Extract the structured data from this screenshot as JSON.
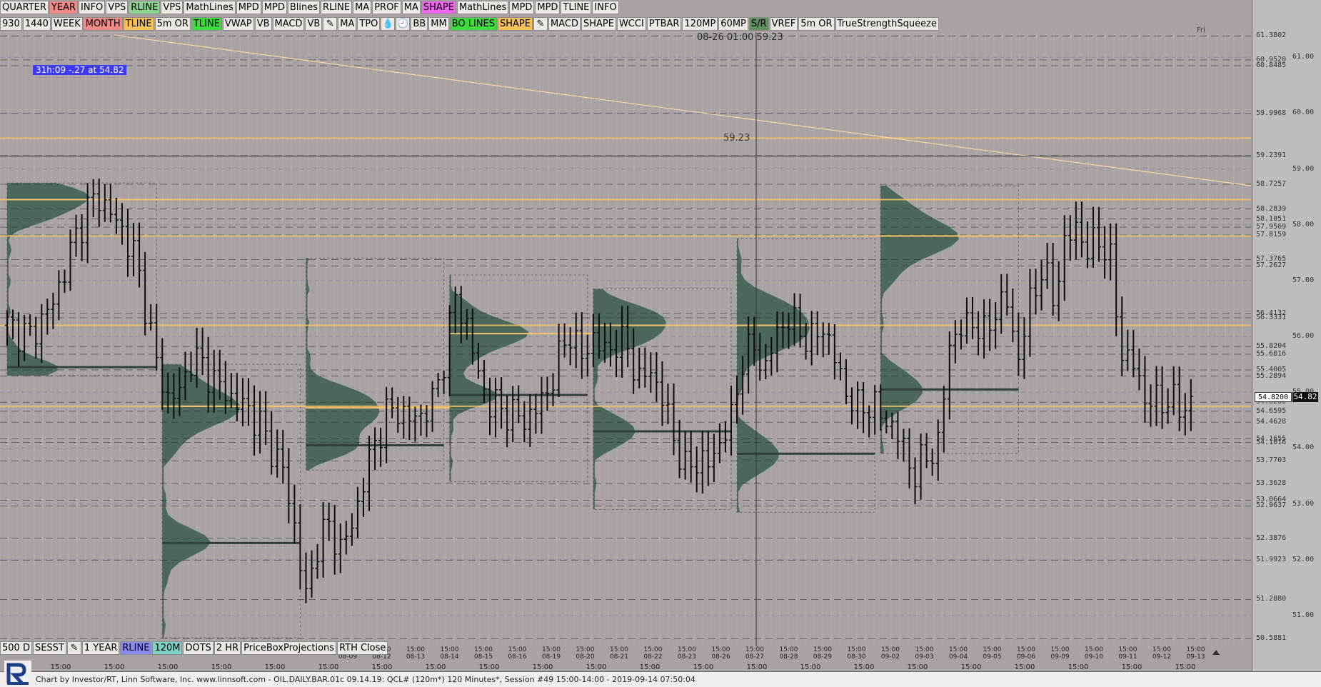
{
  "toolbar_top": [
    {
      "label": "QUARTER",
      "bg": "#ece9e4"
    },
    {
      "label": "YEAR",
      "bg": "#f08a86"
    },
    {
      "label": "INFO",
      "bg": "#ece9e4"
    },
    {
      "label": "VPS",
      "bg": "#ece9e4"
    },
    {
      "label": "RLINE",
      "bg": "#8fd18f"
    },
    {
      "label": "VPS",
      "bg": "#ece9e4"
    },
    {
      "label": "MathLines",
      "bg": "#ece9e4"
    },
    {
      "label": "MPD",
      "bg": "#ece9e4"
    },
    {
      "label": "MPD",
      "bg": "#ece9e4"
    },
    {
      "label": "Blines",
      "bg": "#ece9e4"
    },
    {
      "label": "RLINE",
      "bg": "#ece9e4"
    },
    {
      "label": "MA",
      "bg": "#ece9e4"
    },
    {
      "label": "PROF",
      "bg": "#ece9e4"
    },
    {
      "label": "MA",
      "bg": "#ece9e4"
    },
    {
      "label": "SHAPE",
      "bg": "#ee66ee"
    },
    {
      "label": "MathLines",
      "bg": "#ece9e4"
    },
    {
      "label": "MPD",
      "bg": "#ece9e4"
    },
    {
      "label": "MPD",
      "bg": "#ece9e4"
    },
    {
      "label": "TLINE",
      "bg": "#ece9e4"
    },
    {
      "label": "INFO",
      "bg": "#ece9e4"
    }
  ],
  "toolbar_second": [
    {
      "label": "930",
      "bg": "#ece9e4"
    },
    {
      "label": "1440",
      "bg": "#ece9e4"
    },
    {
      "label": "WEEK",
      "bg": "#ece9e4"
    },
    {
      "label": "MONTH",
      "bg": "#f08a86"
    },
    {
      "label": "TLINE",
      "bg": "#f5c25a"
    },
    {
      "label": "5m OR",
      "bg": "#ece9e4"
    },
    {
      "label": "TLINE",
      "bg": "#3ddc3d"
    },
    {
      "label": "VWAP",
      "bg": "#ece9e4"
    },
    {
      "label": "VB",
      "bg": "#ece9e4"
    },
    {
      "label": "MACD",
      "bg": "#ece9e4"
    },
    {
      "label": "VB",
      "bg": "#ece9e4"
    },
    {
      "icon": "pencil-icon",
      "glyph": "✎",
      "bg": "#ece9e4"
    },
    {
      "label": "MA",
      "bg": "#ece9e4"
    },
    {
      "label": "TPO",
      "bg": "#ece9e4"
    },
    {
      "icon": "droplet-icon",
      "glyph": "💧",
      "bg": "#ece9e4"
    },
    {
      "icon": "clock-icon",
      "glyph": "🕘",
      "bg": "#ece9e4"
    },
    {
      "label": "BB",
      "bg": "#ece9e4"
    },
    {
      "label": "MM",
      "bg": "#ece9e4"
    },
    {
      "label": "BO LINES",
      "bg": "#3ddc3d"
    },
    {
      "label": "SHAPE",
      "bg": "#f5c25a"
    },
    {
      "icon": "pencil-icon",
      "glyph": "✎",
      "bg": "#ece9e4"
    },
    {
      "label": "MACD",
      "bg": "#ece9e4"
    },
    {
      "label": "SHAPE",
      "bg": "#ece9e4"
    },
    {
      "label": "WCCI",
      "bg": "#ece9e4"
    },
    {
      "label": "PTBAR",
      "bg": "#ece9e4"
    },
    {
      "label": "120MP",
      "bg": "#ece9e4"
    },
    {
      "label": "60MP",
      "bg": "#ece9e4"
    },
    {
      "label": "S/R",
      "bg": "#5f8f5f"
    },
    {
      "label": "VREF",
      "bg": "#ece9e4"
    },
    {
      "label": "5m OR",
      "bg": "#ece9e4"
    },
    {
      "label": "TrueStrengthSqueeze",
      "bg": "#ece9e4"
    }
  ],
  "toolbar_bottom": [
    {
      "label": "500 D",
      "bg": "#ece9e4"
    },
    {
      "label": "SESST",
      "bg": "#ece9e4"
    },
    {
      "icon": "pencil-icon",
      "glyph": "✎",
      "bg": "#ece9e4"
    },
    {
      "label": "1 YEAR",
      "bg": "#ece9e4"
    },
    {
      "label": "RLINE",
      "bg": "#8a8af2"
    },
    {
      "label": "120M",
      "bg": "#7ed3c9"
    },
    {
      "label": "DOTS",
      "bg": "#ece9e4"
    },
    {
      "label": "2 HR",
      "bg": "#ece9e4"
    },
    {
      "label": "PriceBoxProjections",
      "bg": "#ece9e4"
    },
    {
      "label": "RTH Close",
      "bg": "#ece9e4"
    }
  ],
  "info_badge": "31h:09   -.27 at 54.82",
  "crosshair_label": "08-26 01:00  59.23",
  "crosshair_price_label": "59.23",
  "day_label": "Fri",
  "last_price_tag": "54.8200",
  "last_price_box": "54.82",
  "footer_text": "Chart by Investor/RT, Linn Software, Inc. www.linnsoft.com - OIL.DAILY.BAR.01c   09.14.19: QCL# (120m*) 120 Minutes*, Session #49 15:00-14:00 - 2019-09-14 07:50:04",
  "colors": {
    "background": "#a9a2a3",
    "candle": "#0c0c0c",
    "profile_fill": "#3b5e4f",
    "hvn_line": "#2f3f3a",
    "poc_line": "#f4c46c",
    "trendline": "#f5d9a3",
    "grid_blue": "#8b8fb6",
    "grid_dashed": "#2b2b2b"
  },
  "chart_data": {
    "type": "candlestick-market-profile",
    "instrument": "QCL# (120m*)",
    "ylim": [
      50.45,
      61.45
    ],
    "y_ticks": [
      51.0,
      52.0,
      53.0,
      54.0,
      55.0,
      56.0,
      57.0,
      58.0,
      59.0,
      60.0,
      61.0
    ],
    "levels": [
      61.3802,
      60.952,
      60.8485,
      59.9968,
      59.2391,
      58.7257,
      58.2839,
      58.1051,
      57.9569,
      57.8159,
      57.3765,
      57.2627,
      56.4132,
      56.3331,
      55.8204,
      55.6816,
      55.4005,
      55.2894,
      54.82,
      54.6595,
      54.4628,
      54.1655,
      54.1016,
      53.7703,
      53.3628,
      53.0664,
      52.9637,
      52.3876,
      51.9923,
      51.288,
      50.5881
    ],
    "date_labels": [
      "08-09",
      "08-12",
      "08-13",
      "08-14",
      "08-15",
      "08-16",
      "08-19",
      "08-20",
      "08-21",
      "08-22",
      "08-23",
      "08-26",
      "08-27",
      "08-28",
      "08-29",
      "08-30",
      "09-02",
      "09-03",
      "09-04",
      "09-05",
      "09-06",
      "09-09",
      "09-10",
      "09-11",
      "09-12",
      "09-13"
    ],
    "session_label": "15:00",
    "close_points": [
      [
        0,
        56.2
      ],
      [
        2,
        56.1
      ],
      [
        4,
        56.0
      ],
      [
        6,
        56.3
      ],
      [
        8,
        56.6
      ],
      [
        10,
        57.2
      ],
      [
        12,
        57.8
      ],
      [
        14,
        58.3
      ],
      [
        16,
        58.5
      ],
      [
        18,
        58.2
      ],
      [
        20,
        57.9
      ],
      [
        22,
        57.5
      ],
      [
        24,
        56.6
      ],
      [
        26,
        55.5
      ],
      [
        28,
        54.9
      ],
      [
        30,
        55.0
      ],
      [
        32,
        55.6
      ],
      [
        34,
        55.5
      ],
      [
        36,
        55.2
      ],
      [
        38,
        55.0
      ],
      [
        40,
        54.8
      ],
      [
        42,
        54.7
      ],
      [
        44,
        54.4
      ],
      [
        46,
        54.0
      ],
      [
        48,
        53.6
      ],
      [
        50,
        52.6
      ],
      [
        52,
        51.3
      ],
      [
        54,
        52.3
      ],
      [
        56,
        52.6
      ],
      [
        58,
        52.2
      ],
      [
        60,
        52.6
      ],
      [
        62,
        53.4
      ],
      [
        64,
        54.1
      ],
      [
        66,
        54.6
      ],
      [
        68,
        54.7
      ],
      [
        70,
        54.5
      ],
      [
        72,
        54.6
      ],
      [
        74,
        54.8
      ],
      [
        76,
        55.6
      ],
      [
        78,
        56.7
      ],
      [
        80,
        56.2
      ],
      [
        82,
        55.3
      ],
      [
        84,
        54.8
      ],
      [
        86,
        54.7
      ],
      [
        88,
        54.6
      ],
      [
        90,
        54.5
      ],
      [
        92,
        54.7
      ],
      [
        94,
        55.0
      ],
      [
        96,
        55.6
      ],
      [
        98,
        56.1
      ],
      [
        100,
        55.6
      ],
      [
        102,
        56.0
      ],
      [
        104,
        55.7
      ],
      [
        106,
        55.9
      ],
      [
        108,
        55.8
      ],
      [
        110,
        55.2
      ],
      [
        112,
        55.4
      ],
      [
        114,
        54.9
      ],
      [
        116,
        54.2
      ],
      [
        118,
        53.6
      ],
      [
        120,
        53.8
      ],
      [
        122,
        53.7
      ],
      [
        124,
        54.1
      ],
      [
        126,
        54.5
      ],
      [
        128,
        55.6
      ],
      [
        130,
        55.8
      ],
      [
        132,
        55.4
      ],
      [
        134,
        56.1
      ],
      [
        136,
        56.3
      ],
      [
        138,
        56.1
      ],
      [
        140,
        55.9
      ],
      [
        142,
        56.2
      ],
      [
        144,
        55.6
      ],
      [
        146,
        55.0
      ],
      [
        148,
        54.7
      ],
      [
        150,
        54.8
      ],
      [
        152,
        54.6
      ],
      [
        154,
        54.4
      ],
      [
        156,
        54.0
      ],
      [
        158,
        53.5
      ],
      [
        160,
        53.9
      ],
      [
        162,
        54.0
      ],
      [
        164,
        55.9
      ],
      [
        166,
        56.1
      ],
      [
        168,
        56.3
      ],
      [
        170,
        56.0
      ],
      [
        172,
        56.5
      ],
      [
        174,
        56.6
      ],
      [
        176,
        55.6
      ],
      [
        178,
        56.6
      ],
      [
        180,
        57.2
      ],
      [
        182,
        56.7
      ],
      [
        184,
        57.6
      ],
      [
        186,
        58.0
      ],
      [
        188,
        57.5
      ],
      [
        190,
        57.8
      ],
      [
        192,
        57.3
      ],
      [
        194,
        55.7
      ],
      [
        196,
        55.5
      ],
      [
        198,
        54.9
      ],
      [
        200,
        54.8
      ],
      [
        202,
        54.9
      ],
      [
        204,
        54.7
      ],
      [
        206,
        54.82
      ]
    ],
    "profiles": [
      {
        "start": 0,
        "end": 26,
        "top": 58.75,
        "bottom": 55.3,
        "poc": 58.45,
        "hvn": 55.45
      },
      {
        "start": 27,
        "end": 51,
        "top": 55.5,
        "bottom": 50.6,
        "poc": 54.75,
        "hvn": 52.3
      },
      {
        "start": 52,
        "end": 76,
        "top": 57.4,
        "bottom": 53.6,
        "poc": 54.72,
        "hvn": 54.05
      },
      {
        "start": 77,
        "end": 101,
        "top": 57.1,
        "bottom": 53.4,
        "poc": 56.05,
        "hvn": 54.95
      },
      {
        "start": 102,
        "end": 126,
        "top": 56.85,
        "bottom": 52.9,
        "poc": 56.2,
        "hvn": 54.3
      },
      {
        "start": 127,
        "end": 151,
        "top": 57.75,
        "bottom": 52.85,
        "poc": 56.2,
        "hvn": 53.9
      },
      {
        "start": 152,
        "end": 176,
        "top": 58.7,
        "bottom": 53.9,
        "poc": 57.8,
        "hvn": 55.05
      }
    ]
  }
}
